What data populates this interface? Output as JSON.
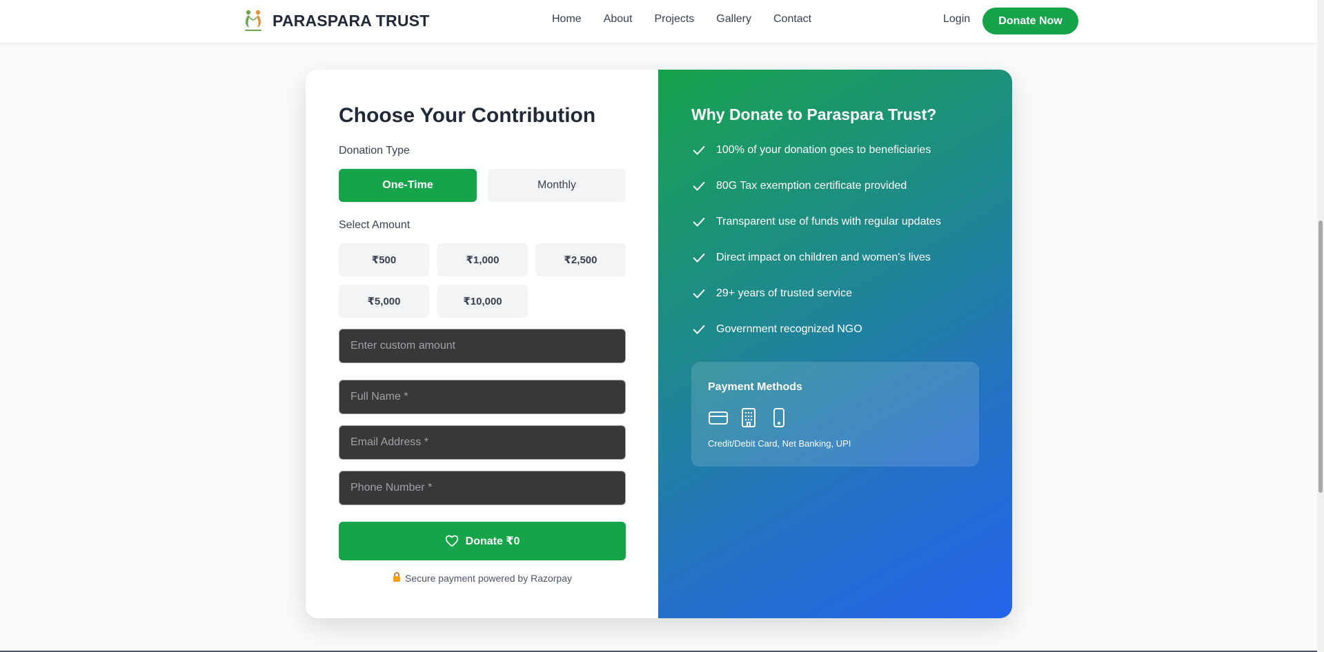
{
  "header": {
    "brand": "PARASPARA TRUST",
    "nav": [
      "Home",
      "About",
      "Projects",
      "Gallery",
      "Contact"
    ],
    "login": "Login",
    "donate_now": "Donate Now"
  },
  "form": {
    "title": "Choose Your Contribution",
    "donation_type_label": "Donation Type",
    "types": [
      "One-Time",
      "Monthly"
    ],
    "selected_type": "One-Time",
    "amount_label": "Select Amount",
    "amounts": [
      "₹500",
      "₹1,000",
      "₹2,500",
      "₹5,000",
      "₹10,000"
    ],
    "custom_amount_placeholder": "Enter custom amount",
    "full_name_placeholder": "Full Name *",
    "email_placeholder": "Email Address *",
    "phone_placeholder": "Phone Number *",
    "donate_button": "Donate ₹0",
    "secure_note": "Secure payment powered by Razorpay"
  },
  "why": {
    "title": "Why Donate to Paraspara Trust?",
    "benefits": [
      "100% of your donation goes to beneficiaries",
      "80G Tax exemption certificate provided",
      "Transparent use of funds with regular updates",
      "Direct impact on children and women's lives",
      "29+ years of trusted service",
      "Government recognized NGO"
    ],
    "payment": {
      "title": "Payment Methods",
      "icons": [
        "credit-card-icon",
        "bank-building-icon",
        "mobile-phone-icon"
      ],
      "description": "Credit/Debit Card, Net Banking, UPI"
    }
  },
  "colors": {
    "primary_green": "#16a34a",
    "gradient_end_blue": "#2563eb",
    "input_bg": "#383838"
  }
}
